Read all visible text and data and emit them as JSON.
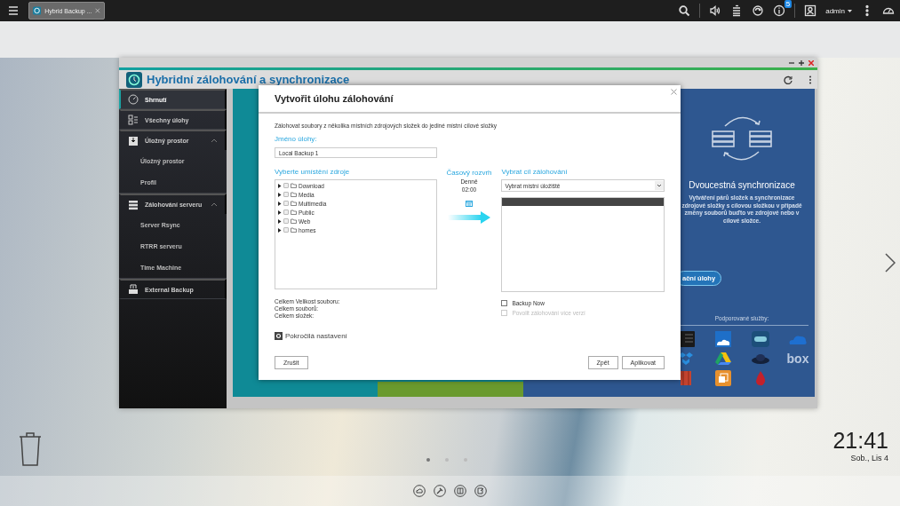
{
  "taskbar": {
    "tabs": [
      {
        "label": "Hybrid Backup ...",
        "selected": true
      }
    ],
    "notification_count": "5",
    "user": "admin"
  },
  "app_window": {
    "title": "Hybridní zálohování a synchronizace",
    "sidebar": [
      {
        "label": "Shrnutí",
        "selected": true
      },
      {
        "label": "Všechny úlohy",
        "selected": false
      },
      {
        "label": "Úložný prostor",
        "selected": false,
        "expanded": true,
        "children": [
          {
            "label": "Úložný prostor",
            "selected": false
          },
          {
            "label": "Profil",
            "selected": false
          }
        ]
      },
      {
        "label": "Zálohování serveru",
        "selected": false,
        "expanded": true,
        "children": [
          {
            "label": "Server Rsync",
            "selected": false
          },
          {
            "label": "RTRR serveru",
            "selected": false
          },
          {
            "label": "Time Machine",
            "selected": false
          }
        ]
      },
      {
        "label": "External Backup",
        "selected": false
      }
    ],
    "sync_panel": {
      "button": "ační úlohy",
      "title": "Dvoucestná synchronizace",
      "description": "Vytváření párů složek a synchronizace zdrojové složky s cílovou složkou v případě změny souborů buďto ve zdrojové nebo v cílové složce.",
      "services_label": "Podporované služby:",
      "logo_text": "box"
    }
  },
  "dialog": {
    "title": "Vytvořit úlohu zálohování",
    "description": "Zálohovat soubory z několika místních zdrojových složek do jediné místní cílové složky",
    "name_label": "Jméno úlohy:",
    "name_value": "Local Backup 1",
    "source_label": "Vyberte umístění zdroje",
    "folders": [
      {
        "label": "Download",
        "checked": false,
        "expanded": false
      },
      {
        "label": "Media",
        "checked": false,
        "expanded": false
      },
      {
        "label": "Multimedia",
        "checked": false,
        "expanded": false
      },
      {
        "label": "Public",
        "checked": false,
        "expanded": false
      },
      {
        "label": "Web",
        "checked": false,
        "expanded": false
      },
      {
        "label": "homes",
        "checked": false,
        "expanded": false
      }
    ],
    "totals": [
      "Celkem Velikost souboru:",
      "Celkem souborů:",
      "Celkem složek:"
    ],
    "advanced": "Pokročilá nastavení",
    "schedule": {
      "label": "Časový rozvrh",
      "frequency": "Denně",
      "time": "02:00"
    },
    "destination_label": "Vybrat cíl zálohování",
    "destination_select": "Vybrat místní úložiště",
    "options": [
      {
        "label": "Backup Now",
        "checked": false,
        "disabled": false
      },
      {
        "label": "Povolit zálohování více verzí",
        "checked": false,
        "disabled": true
      }
    ],
    "cancel": "Zrušit",
    "back": "Zpět",
    "apply": "Aplikovat"
  },
  "desktop": {
    "pages": [
      {
        "selected": true
      },
      {
        "selected": false
      },
      {
        "selected": false
      }
    ],
    "clock": "21:41",
    "date": "Sob., Lis 4"
  }
}
